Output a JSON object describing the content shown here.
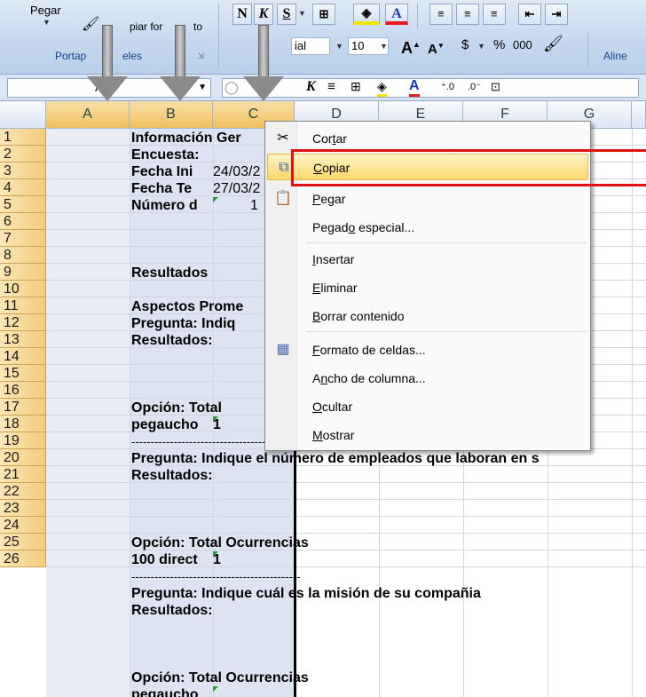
{
  "ribbon": {
    "paste_label": "Pegar",
    "copy_format_label": "piar for",
    "copy_format_label2": "to",
    "clipboard_group": "Portap",
    "clipboard_group2": "eles",
    "font_name": "ial",
    "font_size": "10",
    "bold": "N",
    "italic": "K",
    "underline": "S",
    "currency": "$",
    "percent": "%",
    "thousands": "000",
    "align_group": "Aline"
  },
  "formula_bar": {
    "name_box": "A"
  },
  "columns": [
    "A",
    "B",
    "C",
    "D",
    "E",
    "F",
    "G"
  ],
  "rows": [
    "1",
    "2",
    "3",
    "4",
    "5",
    "6",
    "7",
    "8",
    "9",
    "10",
    "11",
    "12",
    "13",
    "14",
    "15",
    "16",
    "17",
    "18",
    "19",
    "20",
    "21",
    "22",
    "23",
    "24",
    "25",
    "26"
  ],
  "cells": {
    "b1": "Información Ger",
    "b2": "Encuesta:",
    "b3": "Fecha Ini",
    "c3": "24/03/2",
    "b4": "Fecha Te",
    "c4": "27/03/2",
    "b5": "Número d",
    "c5": "1",
    "b7": "Resultados",
    "b9": "Aspectos  Prome",
    "b10": "Pregunta: Indiq",
    "b11": "Resultados:",
    "b13": "Opción:   Total",
    "b14": "pegaucho",
    "c14": "1",
    "b15": "--------------------------------------------",
    "b16": "Pregunta: Indique el número de empleados que laboran en s",
    "b17": "Resultados:",
    "b19": "Opción:   Total Ocurrencias",
    "b20": "100 direct",
    "c20": "1",
    "b21": "--------------------------------------------",
    "b22": "Pregunta: Indique cuál es la misión de su compañia",
    "b23": "Resultados:",
    "b25": "Opción:   Total Ocurrencias",
    "b26": "pegaucho"
  },
  "context_menu": {
    "items": [
      {
        "label": "Cortar",
        "icon": "scissors-icon"
      },
      {
        "label": "Copiar",
        "icon": "copy-icon"
      },
      {
        "label": "Pegar",
        "icon": "paste-icon"
      },
      {
        "label": "Pegado especial...",
        "icon": ""
      },
      {
        "label": "Insertar",
        "icon": ""
      },
      {
        "label": "Eliminar",
        "icon": ""
      },
      {
        "label": "Borrar contenido",
        "icon": ""
      },
      {
        "label": "Formato de celdas...",
        "icon": "format-cells-icon"
      },
      {
        "label": "Ancho de columna...",
        "icon": ""
      },
      {
        "label": "Ocultar",
        "icon": ""
      },
      {
        "label": "Mostrar",
        "icon": ""
      }
    ],
    "highlighted": "Copiar"
  },
  "colors": {
    "highlight": "#ffd86b",
    "annotation_box": "#e11212",
    "row_header": "#f5cc7b"
  }
}
